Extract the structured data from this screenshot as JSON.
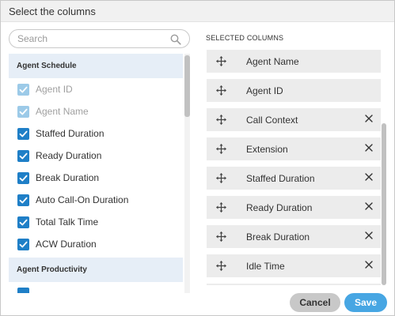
{
  "dialog": {
    "title": "Select the columns"
  },
  "search": {
    "placeholder": "Search",
    "value": ""
  },
  "available": {
    "groups": [
      {
        "label": "Agent Schedule",
        "items": [
          {
            "label": "Agent ID",
            "checked": true,
            "disabled": true
          },
          {
            "label": "Agent Name",
            "checked": true,
            "disabled": true
          },
          {
            "label": "Staffed Duration",
            "checked": true,
            "disabled": false
          },
          {
            "label": "Ready Duration",
            "checked": true,
            "disabled": false
          },
          {
            "label": "Break Duration",
            "checked": true,
            "disabled": false
          },
          {
            "label": "Auto Call-On Duration",
            "checked": true,
            "disabled": false
          },
          {
            "label": "Total Talk Time",
            "checked": true,
            "disabled": false
          },
          {
            "label": "ACW Duration",
            "checked": true,
            "disabled": false
          }
        ]
      },
      {
        "label": "Agent Productivity",
        "items": []
      }
    ]
  },
  "selected": {
    "title": "SELECTED COLUMNS",
    "items": [
      {
        "label": "Agent Name",
        "removable": false
      },
      {
        "label": "Agent ID",
        "removable": false
      },
      {
        "label": "Call Context",
        "removable": true
      },
      {
        "label": "Extension",
        "removable": true
      },
      {
        "label": "Staffed Duration",
        "removable": true
      },
      {
        "label": "Ready Duration",
        "removable": true
      },
      {
        "label": "Break Duration",
        "removable": true
      },
      {
        "label": "Idle Time",
        "removable": true
      }
    ]
  },
  "buttons": {
    "cancel": "Cancel",
    "save": "Save"
  },
  "colors": {
    "accent": "#1f7fc7",
    "accent_disabled": "#9ccae8",
    "save": "#47a6e3",
    "group_header_bg": "#e6eef7",
    "row_bg": "#ececec"
  },
  "icons": {
    "search": "magnifier",
    "drag": "four-way-arrows",
    "remove": "close-x",
    "check": "checkmark"
  }
}
